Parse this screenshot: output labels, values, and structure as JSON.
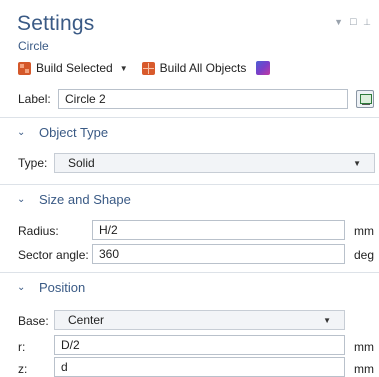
{
  "header": {
    "title": "Settings",
    "subtitle": "Circle"
  },
  "toolbar": {
    "build_selected_label": "Build Selected",
    "build_all_label": "Build All Objects"
  },
  "label_field": {
    "label": "Label:",
    "value": "Circle 2"
  },
  "sections": {
    "object_type": {
      "title": "Object Type",
      "type_label": "Type:",
      "type_value": "Solid"
    },
    "size_shape": {
      "title": "Size and Shape",
      "radius_label": "Radius:",
      "radius_value": "H/2",
      "radius_unit": "mm",
      "sector_label": "Sector angle:",
      "sector_value": "360",
      "sector_unit": "deg"
    },
    "position": {
      "title": "Position",
      "base_label": "Base:",
      "base_value": "Center",
      "r_label": "r:",
      "r_value": "D/2",
      "r_unit": "mm",
      "z_label": "z:",
      "z_value": "d",
      "z_unit": "mm"
    }
  }
}
